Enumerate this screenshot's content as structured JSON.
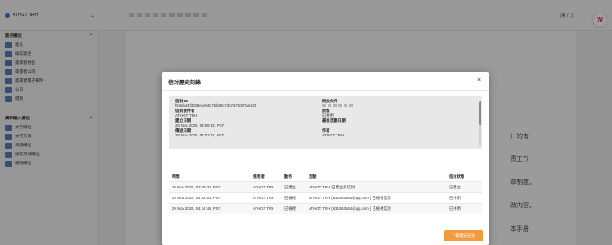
{
  "app": {
    "environment": "ATHGT TRH",
    "page_indicator": "(第 / 1)",
    "logo": "W"
  },
  "sidebar": {
    "section1": {
      "title": "簽名欄位",
      "items": [
        {
          "label": "簽名",
          "icon": "signature-icon"
        },
        {
          "label": "縮寫簽名",
          "icon": "initials-icon"
        },
        {
          "label": "簽署者姓名",
          "icon": "person-icon"
        },
        {
          "label": "簽署者公司",
          "icon": "building-icon"
        },
        {
          "label": "簽署者電子郵件",
          "icon": "mail-icon"
        },
        {
          "label": "公司",
          "icon": "company-icon"
        },
        {
          "label": "標題",
          "icon": "title-icon"
        }
      ]
    },
    "section2": {
      "title": "資料輸入欄位",
      "items": [
        {
          "label": "文字欄位",
          "icon": "text-field-icon"
        },
        {
          "label": "文字方塊",
          "icon": "text-box-icon"
        },
        {
          "label": "日期欄位",
          "icon": "calendar-icon"
        },
        {
          "label": "核取方塊欄位",
          "icon": "checkbox-icon"
        },
        {
          "label": "選項欄位",
          "icon": "radio-icon"
        }
      ]
    }
  },
  "document": {
    "fragments": [
      "）的有",
      "责工”）",
      "章制度。",
      "改内容。",
      "本手册"
    ]
  },
  "modal": {
    "title": "信封歷史記錄",
    "close": "×",
    "info": {
      "envelope_id_label": "信封 ID",
      "envelope_id": "f63eb44f3d38cee5537bb68c7db7d76007ae225",
      "attachment_label": "附加文件",
      "holder_label": "信封收件者",
      "holder": "ATHGT TRH",
      "status_label": "狀態",
      "status": "已共用",
      "created_label": "建立日期",
      "created": "29 Nov 2025, 03:59:33, PST",
      "last_activity_label": "最後活動日期",
      "sent_label": "傳送日期",
      "sent": "29 Nov 2025, 04:02:02, PST",
      "author_label": "作者",
      "author": "ATHGT TRH",
      "holder_extra_label": "作者",
      "holder_extra": "ATHGT TRH"
    },
    "history": {
      "headers": [
        "時間",
        "使用者",
        "動作",
        "活動",
        "信封狀態"
      ],
      "rows": [
        [
          "29 Nov 2025, 03:59:33, PST",
          "ATHGT TRH",
          "已建立",
          "ATHGT TRH 已建立此信封",
          "已建立"
        ],
        [
          "29 Nov 2025, 04:02:03, PST",
          "ATHGT TRH",
          "已檢視",
          "ATHGT TRH (631063564@qq.com ) 已檢視信封",
          "已共用"
        ],
        [
          "29 Nov 2025, 04:14:46, PST",
          "ATHGT TRH",
          "已檢視",
          "ATHGT TRH (631063564@qq.com ) 已檢視信封",
          "已共用"
        ]
      ]
    },
    "download_button": "下載歷史記錄"
  }
}
